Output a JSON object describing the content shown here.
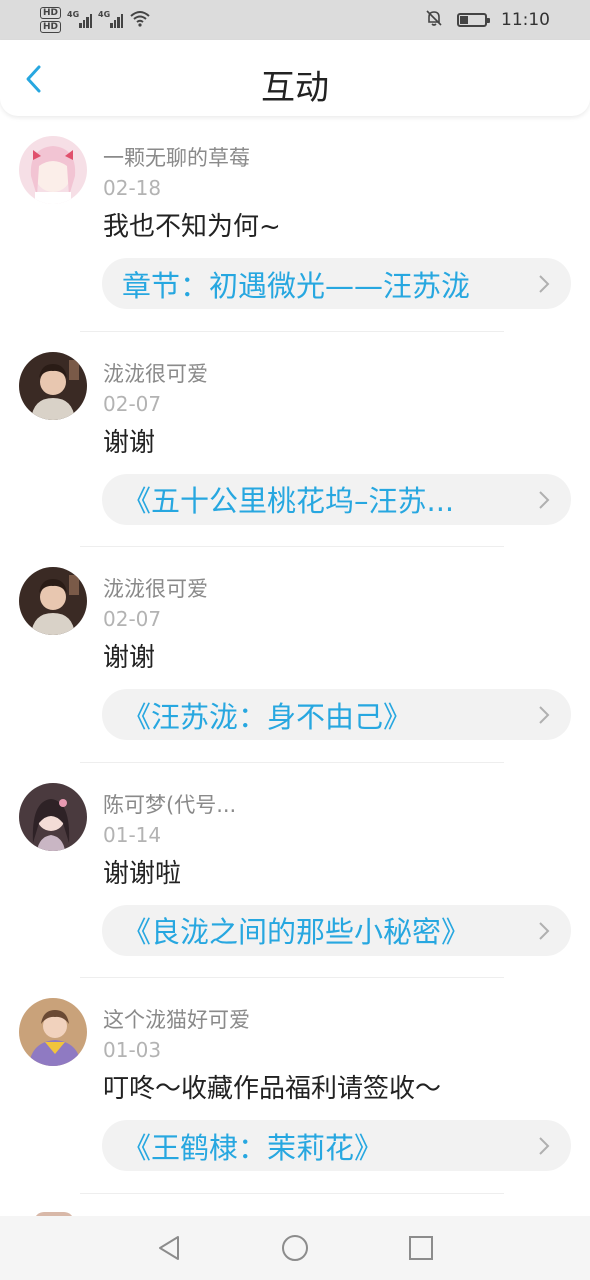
{
  "status_bar": {
    "time": "11:10",
    "left_badges": [
      "HD",
      "HD"
    ],
    "network_labels": [
      "4G",
      "4G"
    ],
    "icons": [
      "signal-icon",
      "signal-icon",
      "wifi-icon",
      "mute-icon",
      "battery-icon"
    ]
  },
  "header": {
    "title": "互动",
    "back_icon": "chevron-left-icon",
    "accent_color": "#27a7e0"
  },
  "items": [
    {
      "user": "一颗无聊的草莓",
      "date": "02-18",
      "message": "我也不知为何~",
      "work": "章节：初遇微光——汪苏泷"
    },
    {
      "user": "泷泷很可爱",
      "date": "02-07",
      "message": "谢谢",
      "work": "《五十公里桃花坞–汪苏..."
    },
    {
      "user": "泷泷很可爱",
      "date": "02-07",
      "message": "谢谢",
      "work": "《汪苏泷：身不由己》"
    },
    {
      "user": "陈可梦(代号...",
      "date": "01-14",
      "message": "谢谢啦",
      "work": "《良泷之间的那些小秘密》"
    },
    {
      "user": "这个泷猫好可爱",
      "date": "01-03",
      "message": "叮咚～收藏作品福利请签收～",
      "work": "《王鹤棣：茉莉花》"
    }
  ],
  "nav_bar": {
    "icons": [
      "back-triangle-icon",
      "home-circle-icon",
      "recents-square-icon"
    ]
  }
}
